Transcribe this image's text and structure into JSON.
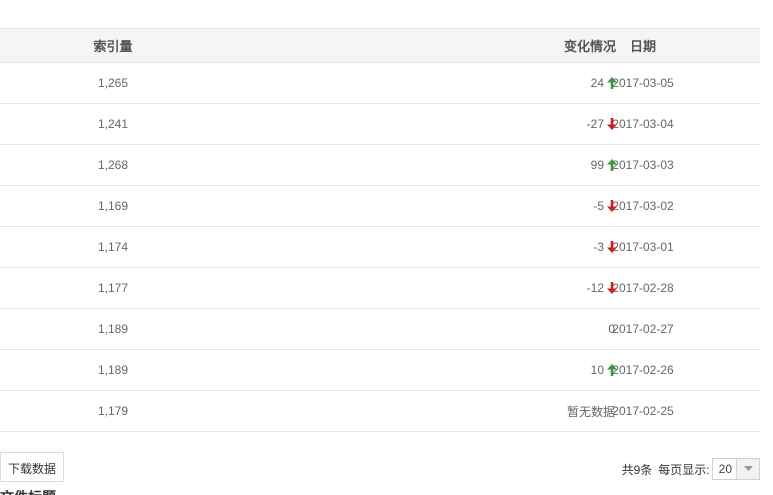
{
  "table": {
    "headers": {
      "index": "索引量",
      "change": "变化情况",
      "date": "日期"
    },
    "rows": [
      {
        "index": "1,265",
        "change": "24",
        "direction": "up",
        "date": "2017-03-05"
      },
      {
        "index": "1,241",
        "change": "-27",
        "direction": "down",
        "date": "2017-03-04"
      },
      {
        "index": "1,268",
        "change": "99",
        "direction": "up",
        "date": "2017-03-03"
      },
      {
        "index": "1,169",
        "change": "-5",
        "direction": "down",
        "date": "2017-03-02"
      },
      {
        "index": "1,174",
        "change": "-3",
        "direction": "down",
        "date": "2017-03-01"
      },
      {
        "index": "1,177",
        "change": "-12",
        "direction": "down",
        "date": "2017-02-28"
      },
      {
        "index": "1,189",
        "change": "0",
        "direction": "none",
        "date": "2017-02-27"
      },
      {
        "index": "1,189",
        "change": "10",
        "direction": "up",
        "date": "2017-02-26"
      },
      {
        "index": "1,179",
        "change": "暂无数据",
        "direction": "none",
        "date": "2017-02-25"
      }
    ]
  },
  "toolbar": {
    "download_label": "下载数据"
  },
  "pager": {
    "total": "共9条",
    "per_page_label": "每页显示:",
    "per_page_value": "20"
  },
  "section_heading_partial": "文件标题",
  "colors": {
    "up": "#3c9a3c",
    "down": "#d9181b",
    "header_bg": "#f5f5f5"
  },
  "icons": {
    "up": "arrow-up-icon",
    "down": "arrow-down-icon",
    "select": "chevron-down-icon"
  }
}
